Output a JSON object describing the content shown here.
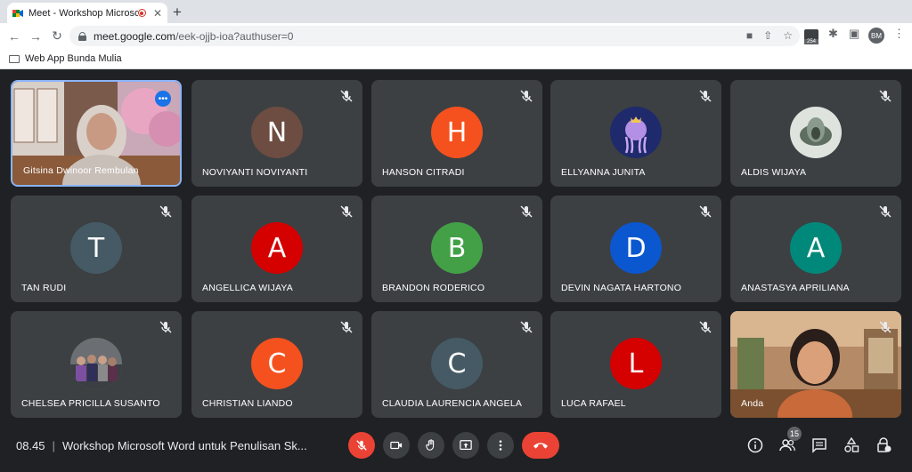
{
  "browser": {
    "tab_title": "Meet - Workshop Microsof",
    "new_tab": "+",
    "url_host": "meet.google.com",
    "url_path": "/eek-ojjb-ioa?authuser=0",
    "profile_initials": "BM",
    "extension_badge": "254",
    "bookmark_folder": "Web App Bunda Mulia"
  },
  "participants": [
    {
      "name": "Gitsina Dwinoor Rembulan",
      "type": "video",
      "active": true
    },
    {
      "name": "NOVIYANTI NOVIYANTI",
      "initial": "N",
      "color": "#6d4c41"
    },
    {
      "name": "HANSON CITRADI",
      "initial": "H",
      "color": "#f4511e"
    },
    {
      "name": "ELLYANNA JUNITA",
      "type": "photo"
    },
    {
      "name": "ALDIS WIJAYA",
      "type": "photo"
    },
    {
      "name": "TAN RUDI",
      "initial": "T",
      "color": "#455a64"
    },
    {
      "name": "ANGELLICA WIJAYA",
      "initial": "A",
      "color": "#d50000"
    },
    {
      "name": "BRANDON RODERICO",
      "initial": "B",
      "color": "#43a047"
    },
    {
      "name": "DEVIN NAGATA HARTONO",
      "initial": "D",
      "color": "#0b57d0"
    },
    {
      "name": "ANASTASYA APRILIANA",
      "initial": "A",
      "color": "#00897b"
    },
    {
      "name": "CHELSEA PRICILLA SUSANTO",
      "type": "photo"
    },
    {
      "name": "CHRISTIAN LIANDO",
      "initial": "C",
      "color": "#f4511e"
    },
    {
      "name": "CLAUDIA LAURENCIA ANGELA",
      "initial": "C",
      "color": "#455a64"
    },
    {
      "name": "LUCA RAFAEL",
      "initial": "L",
      "color": "#d50000"
    },
    {
      "name": "Anda",
      "type": "video"
    }
  ],
  "meeting": {
    "time": "08.45",
    "separator": "|",
    "title": "Workshop Microsoft Word untuk Penulisan Sk...",
    "participant_count": "15"
  }
}
